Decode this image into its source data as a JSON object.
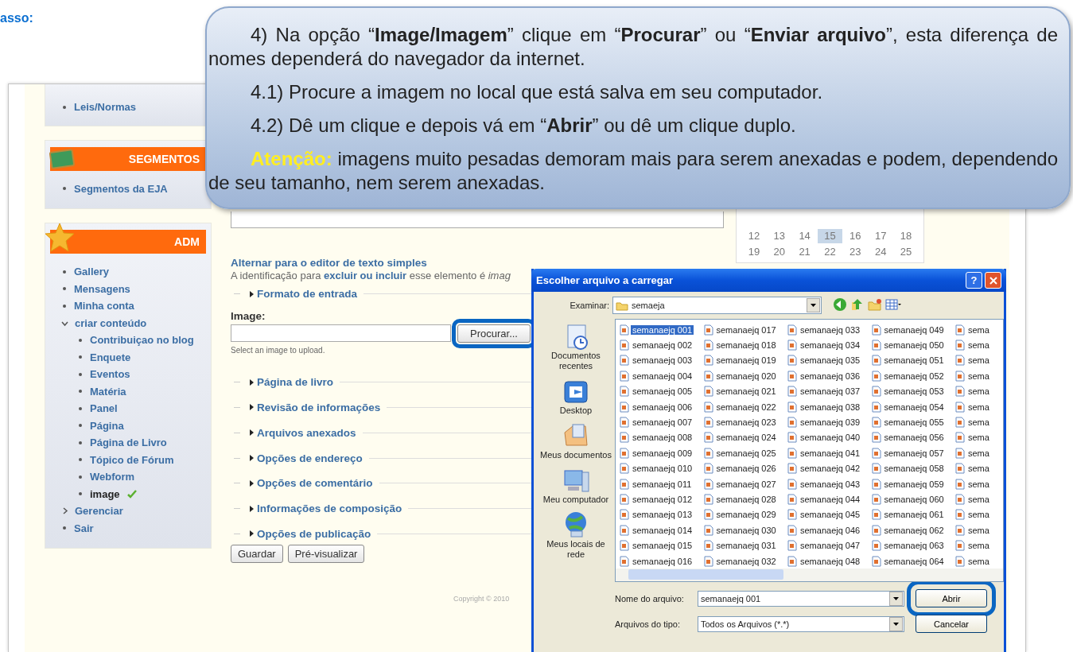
{
  "heading": "asso:",
  "callout": {
    "paragraphs": [
      {
        "kind": "text",
        "text": "4) Na opção “**Image/Imagem**” clique em “**Procurar**” ou “**Enviar arquivo**”, esta diferença de nomes dependerá do navegador da internet."
      },
      {
        "kind": "text",
        "text": "4.1) Procure a imagem no local que está salva em seu computador."
      },
      {
        "kind": "text",
        "text": "4.2) Dê um clique e depois vá em “**Abrir**” ou dê um clique duplo."
      },
      {
        "kind": "warning",
        "label": "Atenção:",
        "text": "imagens muito pesadas demoram mais para serem anexadas e podem, dependendo de seu tamanho, nem serem anexadas."
      }
    ]
  },
  "sidebar": {
    "blocks": [
      {
        "items": [
          {
            "label": "Leis/Normas",
            "selected": false
          }
        ]
      },
      {
        "title": "SEGMENTOS",
        "items": [
          {
            "label": "Segmentos da EJA",
            "selected": false
          }
        ]
      },
      {
        "title": "ADM",
        "items": [
          {
            "label": "Gallery",
            "selected": false
          },
          {
            "label": "Mensagens",
            "selected": false
          },
          {
            "label": "Minha conta",
            "selected": false
          },
          {
            "label": "criar conteúdo",
            "selected": false,
            "expanded": true,
            "children": [
              {
                "label": "Contribuiçao no blog",
                "selected": false
              },
              {
                "label": "Enquete",
                "selected": false
              },
              {
                "label": "Eventos",
                "selected": false
              },
              {
                "label": "Matéria",
                "selected": false
              },
              {
                "label": "Panel",
                "selected": false
              },
              {
                "label": "Página",
                "selected": false
              },
              {
                "label": "Página de Livro",
                "selected": false
              },
              {
                "label": "Tópico de Fórum",
                "selected": false
              },
              {
                "label": "Webform",
                "selected": false
              },
              {
                "label": "image",
                "selected": true
              }
            ]
          },
          {
            "label": "Gerenciar",
            "selected": false,
            "expanded": false
          },
          {
            "label": "Sair",
            "selected": false
          }
        ]
      }
    ]
  },
  "form": {
    "editor_link": "Alternar para o editor de texto simples",
    "identifier_note": "A identificação para **excluir ou incluir** esse elemento é *imag*",
    "sections_top": [
      "Formato de entrada"
    ],
    "image_field": {
      "label": "Image:",
      "button": "Procurar...",
      "highlighted": true,
      "description": "Select an image to upload."
    },
    "sections": [
      "Página de livro",
      "Revisão de informações",
      "Arquivos anexados",
      "Opções de endereço",
      "Opções de comentário",
      "Informações de composição",
      "Opções de publicação"
    ],
    "buttons": [
      "Guardar",
      "Pré-visualizar"
    ],
    "footer": "Copyright © 2010"
  },
  "calendar": {
    "rows": [
      [
        {
          "label": "12",
          "selected": false
        },
        {
          "label": "13",
          "selected": false
        },
        {
          "label": "14",
          "selected": false
        },
        {
          "label": "15",
          "selected": true
        },
        {
          "label": "16",
          "selected": false
        },
        {
          "label": "17",
          "selected": false
        },
        {
          "label": "18",
          "selected": false
        }
      ],
      [
        {
          "label": "19",
          "selected": false
        },
        {
          "label": "20",
          "selected": false
        },
        {
          "label": "21",
          "selected": false
        },
        {
          "label": "22",
          "selected": false
        },
        {
          "label": "23",
          "selected": false
        },
        {
          "label": "24",
          "selected": false
        },
        {
          "label": "25",
          "selected": false
        }
      ]
    ]
  },
  "dialog": {
    "title": "Escolher arquivo a carregar",
    "help": "?",
    "lookin_label": "Examinar:",
    "folder": "semaeja",
    "places": [
      "Documentos recentes",
      "Desktop",
      "Meus documentos",
      "Meu computador",
      "Meus locais de rede"
    ],
    "file_columns": [
      [
        {
          "name": "semanaejq 001",
          "selected": true
        },
        {
          "name": "semanaejq 002",
          "selected": false
        },
        {
          "name": "semanaejq 003",
          "selected": false
        },
        {
          "name": "semanaejq 004",
          "selected": false
        },
        {
          "name": "semanaejq 005",
          "selected": false
        },
        {
          "name": "semanaejq 006",
          "selected": false
        },
        {
          "name": "semanaejq 007",
          "selected": false
        },
        {
          "name": "semanaejq 008",
          "selected": false
        },
        {
          "name": "semanaejq 009",
          "selected": false
        },
        {
          "name": "semanaejq 010",
          "selected": false
        },
        {
          "name": "semanaejq 011",
          "selected": false
        },
        {
          "name": "semanaejq 012",
          "selected": false
        },
        {
          "name": "semanaejq 013",
          "selected": false
        },
        {
          "name": "semanaejq 014",
          "selected": false
        },
        {
          "name": "semanaejq 015",
          "selected": false
        },
        {
          "name": "semanaejq 016",
          "selected": false
        }
      ],
      [
        {
          "name": "semanaejq 017",
          "selected": false
        },
        {
          "name": "semanaejq 018",
          "selected": false
        },
        {
          "name": "semanaejq 019",
          "selected": false
        },
        {
          "name": "semanaejq 020",
          "selected": false
        },
        {
          "name": "semanaejq 021",
          "selected": false
        },
        {
          "name": "semanaejq 022",
          "selected": false
        },
        {
          "name": "semanaejq 023",
          "selected": false
        },
        {
          "name": "semanaejq 024",
          "selected": false
        },
        {
          "name": "semanaejq 025",
          "selected": false
        },
        {
          "name": "semanaejq 026",
          "selected": false
        },
        {
          "name": "semanaejq 027",
          "selected": false
        },
        {
          "name": "semanaejq 028",
          "selected": false
        },
        {
          "name": "semanaejq 029",
          "selected": false
        },
        {
          "name": "semanaejq 030",
          "selected": false
        },
        {
          "name": "semanaejq 031",
          "selected": false
        },
        {
          "name": "semanaejq 032",
          "selected": false
        }
      ],
      [
        {
          "name": "semanaejq 033",
          "selected": false
        },
        {
          "name": "semanaejq 034",
          "selected": false
        },
        {
          "name": "semanaejq 035",
          "selected": false
        },
        {
          "name": "semanaejq 036",
          "selected": false
        },
        {
          "name": "semanaejq 037",
          "selected": false
        },
        {
          "name": "semanaejq 038",
          "selected": false
        },
        {
          "name": "semanaejq 039",
          "selected": false
        },
        {
          "name": "semanaejq 040",
          "selected": false
        },
        {
          "name": "semanaejq 041",
          "selected": false
        },
        {
          "name": "semanaejq 042",
          "selected": false
        },
        {
          "name": "semanaejq 043",
          "selected": false
        },
        {
          "name": "semanaejq 044",
          "selected": false
        },
        {
          "name": "semanaejq 045",
          "selected": false
        },
        {
          "name": "semanaejq 046",
          "selected": false
        },
        {
          "name": "semanaejq 047",
          "selected": false
        },
        {
          "name": "semanaejq 048",
          "selected": false
        }
      ],
      [
        {
          "name": "semanaejq 049",
          "selected": false
        },
        {
          "name": "semanaejq 050",
          "selected": false
        },
        {
          "name": "semanaejq 051",
          "selected": false
        },
        {
          "name": "semanaejq 052",
          "selected": false
        },
        {
          "name": "semanaejq 053",
          "selected": false
        },
        {
          "name": "semanaejq 054",
          "selected": false
        },
        {
          "name": "semanaejq 055",
          "selected": false
        },
        {
          "name": "semanaejq 056",
          "selected": false
        },
        {
          "name": "semanaejq 057",
          "selected": false
        },
        {
          "name": "semanaejq 058",
          "selected": false
        },
        {
          "name": "semanaejq 059",
          "selected": false
        },
        {
          "name": "semanaejq 060",
          "selected": false
        },
        {
          "name": "semanaejq 061",
          "selected": false
        },
        {
          "name": "semanaejq 062",
          "selected": false
        },
        {
          "name": "semanaejq 063",
          "selected": false
        },
        {
          "name": "semanaejq 064",
          "selected": false
        }
      ],
      [
        {
          "name": "sema",
          "selected": false
        },
        {
          "name": "sema",
          "selected": false
        },
        {
          "name": "sema",
          "selected": false
        },
        {
          "name": "sema",
          "selected": false
        },
        {
          "name": "sema",
          "selected": false
        },
        {
          "name": "sema",
          "selected": false
        },
        {
          "name": "sema",
          "selected": false
        },
        {
          "name": "sema",
          "selected": false
        },
        {
          "name": "sema",
          "selected": false
        },
        {
          "name": "sema",
          "selected": false
        },
        {
          "name": "sema",
          "selected": false
        },
        {
          "name": "sema",
          "selected": false
        },
        {
          "name": "sema",
          "selected": false
        },
        {
          "name": "sema",
          "selected": false
        },
        {
          "name": "sema",
          "selected": false
        },
        {
          "name": "sema",
          "selected": false
        }
      ]
    ],
    "filename_label": "Nome do arquivo:",
    "filename": "semanaejq 001",
    "filetype_label": "Arquivos do tipo:",
    "filetype": "Todos os Arquivos (*.*)",
    "buttons": [
      {
        "label": "Abrir",
        "highlighted": true
      },
      {
        "label": "Cancelar",
        "highlighted": false
      }
    ]
  }
}
